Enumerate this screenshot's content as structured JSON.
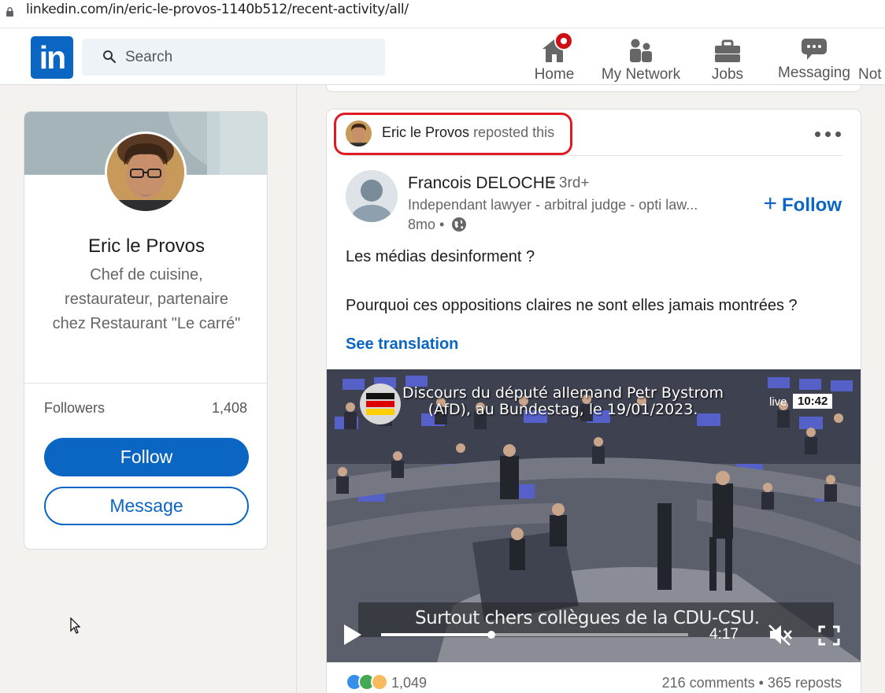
{
  "browser": {
    "url": "linkedin.com/in/eric-le-provos-1140b512/recent-activity/all/"
  },
  "nav": {
    "logo": "in",
    "search_placeholder": "Search",
    "items": [
      {
        "label": "Home",
        "icon": "home-icon"
      },
      {
        "label": "My Network",
        "icon": "network-icon"
      },
      {
        "label": "Jobs",
        "icon": "briefcase-icon"
      },
      {
        "label": "Messaging",
        "icon": "chat-icon"
      },
      {
        "label": "Not",
        "icon": "bell-icon"
      }
    ]
  },
  "profile": {
    "name": "Eric le Provos",
    "headline": "Chef de cuisine, restaurateur, partenaire chez Restaurant \"Le carré\"",
    "followers_label": "Followers",
    "followers_count": "1,408",
    "follow_button": "Follow",
    "message_button": "Message"
  },
  "post": {
    "reposter": "Eric le Provos",
    "repost_suffix": "reposted this",
    "author_name": "Francois DELOCHE",
    "author_degree": "• 3rd+",
    "author_headline": "Independant lawyer - arbitral judge - opti law...",
    "time": "8mo •",
    "follow_label": "Follow",
    "text_line1": "Les médias desinforment ?",
    "text_line2": "Pourquoi ces oppositions claires ne sont elles jamais montrées ?",
    "see_translation": "See translation",
    "video": {
      "caption_line1": "Discours du député allemand Petr Bystrom",
      "caption_line2": "(AfD), au Bundestag, le 19/01/2023.",
      "live_label": "live",
      "live_time": "10:42",
      "subtitle": "Surtout chers collègues de la CDU-CSU.",
      "duration": "4:17",
      "progress": 0.36
    },
    "reactions_count": "1,049",
    "comments_reposts": "216 comments • 365 reposts"
  },
  "colors": {
    "brand": "#0a66c2",
    "highlight": "#e01b24",
    "notification": "#cc1016"
  }
}
